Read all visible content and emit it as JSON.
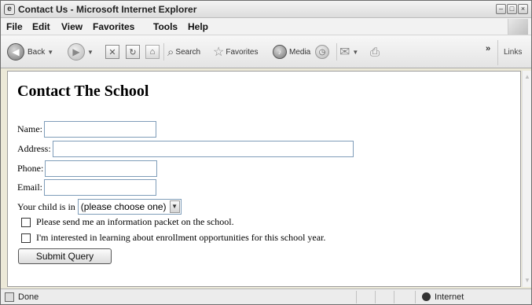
{
  "window": {
    "title": "Contact Us - Microsoft Internet Explorer"
  },
  "menubar": {
    "items": [
      "File",
      "Edit",
      "View",
      "Favorites",
      "Tools",
      "Help"
    ]
  },
  "toolbar": {
    "back_label": "Back",
    "search_label": "Search",
    "favorites_label": "Favorites",
    "media_label": "Media",
    "overflow": "»",
    "links_label": "Links"
  },
  "page": {
    "heading": "Contact The School",
    "name_label": "Name:",
    "address_label": "Address:",
    "phone_label": "Phone:",
    "email_label": "Email:",
    "child_label": "Your child is in",
    "child_select_value": "(please choose one)",
    "checkbox1_label": "Please send me an information packet on the school.",
    "checkbox2_label": "I'm interested in learning about enrollment opportunities for this school year.",
    "submit_label": "Submit Query"
  },
  "statusbar": {
    "status_text": "Done",
    "zone_text": "Internet"
  }
}
